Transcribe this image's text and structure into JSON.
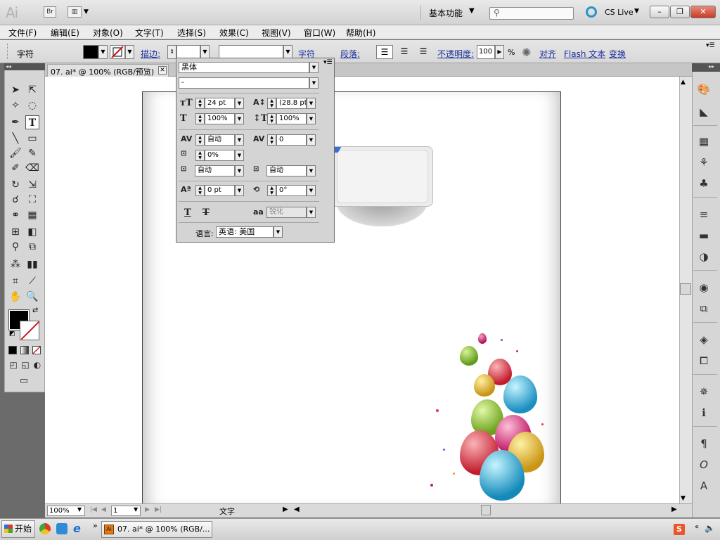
{
  "app": {
    "logo": "Ai",
    "bridge_label": "Br",
    "workspace": "基本功能",
    "cs_live": "CS Live",
    "window_min": "–",
    "window_max": "❐",
    "window_close": "✕"
  },
  "menu": [
    "文件(F)",
    "编辑(E)",
    "对象(O)",
    "文字(T)",
    "选择(S)",
    "效果(C)",
    "视图(V)",
    "窗口(W)",
    "帮助(H)"
  ],
  "control_bar": {
    "mode_label": "字符",
    "stroke_label": "描边:",
    "char_link": "字符",
    "para_link": "段落:",
    "opacity_link": "不透明度:",
    "opacity_value": "100",
    "opacity_unit": "%",
    "align_link": "对齐",
    "flash_link": "Flash 文本",
    "transform_link": "变换"
  },
  "document": {
    "tab_title": "07. ai* @ 100% (RGB/预览)",
    "zoom": "100%",
    "page": "1",
    "status_text": "文字"
  },
  "character_panel": {
    "font_family": "黑体",
    "font_style": "-",
    "font_size": "24 pt",
    "leading": "(28.8 pt)",
    "horizontal_scale": "100%",
    "vertical_scale": "100%",
    "kerning": "自动",
    "tracking": "0",
    "tsume": "0%",
    "insert_left": "自动",
    "insert_right": "自动",
    "baseline_shift": "0 pt",
    "rotation": "0°",
    "anti_alias": "锐化",
    "language_label": "语言:",
    "language": "英语: 美国"
  },
  "taskbar": {
    "start": "开始",
    "task_title": "07. ai* @ 100% (RGB/...",
    "ai_icon_label": "Ai"
  }
}
